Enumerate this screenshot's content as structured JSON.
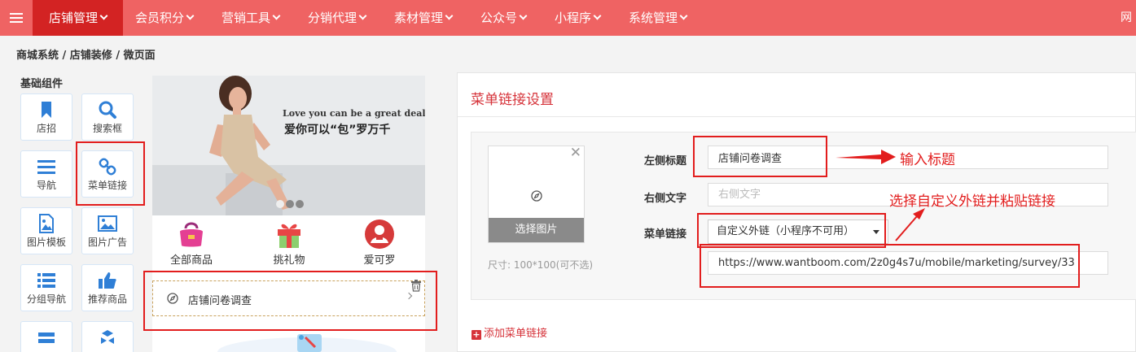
{
  "nav": {
    "items": [
      {
        "label": "店铺管理"
      },
      {
        "label": "会员积分"
      },
      {
        "label": "营销工具"
      },
      {
        "label": "分销代理"
      },
      {
        "label": "素材管理"
      },
      {
        "label": "公众号"
      },
      {
        "label": "小程序"
      },
      {
        "label": "系统管理"
      }
    ],
    "brand_partial": "网"
  },
  "breadcrumb": "商城系统 / 店铺装修 / 微页面",
  "components": {
    "title": "基础组件",
    "items": [
      {
        "label": "店招",
        "icon": "bookmark-icon"
      },
      {
        "label": "搜索框",
        "icon": "search-icon"
      },
      {
        "label": "导航",
        "icon": "list-icon"
      },
      {
        "label": "菜单链接",
        "icon": "link-icon"
      },
      {
        "label": "图片模板",
        "icon": "image-file-icon"
      },
      {
        "label": "图片广告",
        "icon": "picture-icon"
      },
      {
        "label": "分组导航",
        "icon": "grouped-list-icon"
      },
      {
        "label": "推荐商品",
        "icon": "thumbs-up-icon"
      }
    ]
  },
  "preview": {
    "banner_en": "Love you can be a great deal",
    "banner_cn": "爱你可以“包”罗万千",
    "quick_links": [
      {
        "label": "全部商品",
        "icon": "bag-icon"
      },
      {
        "label": "挑礼物",
        "icon": "gift-icon"
      },
      {
        "label": "爱可罗",
        "icon": "brand-logo-icon"
      }
    ],
    "menu_link_label": "店铺问卷调查"
  },
  "panel": {
    "title": "菜单链接设置",
    "choose_image": "选择图片",
    "size_hint": "尺寸: 100*100(可不选)",
    "left_title_label": "左侧标题",
    "left_title_value": "店铺问卷调查",
    "right_text_label": "右侧文字",
    "right_text_placeholder": "右侧文字",
    "menu_link_label": "菜单链接",
    "menu_link_type": "自定义外链（小程序不可用）",
    "url_value": "https://www.wantboom.com/2z0g4s7u/mobile/marketing/survey/33",
    "add_link": "添加菜单链接"
  },
  "annotations": {
    "input_title": "输入标题",
    "choose_link": "选择自定义外链并粘贴链接"
  },
  "colors": {
    "nav_bg": "#ef6363",
    "nav_active": "#d32323",
    "accent": "#d6333a",
    "annotation": "#e21d1d"
  }
}
